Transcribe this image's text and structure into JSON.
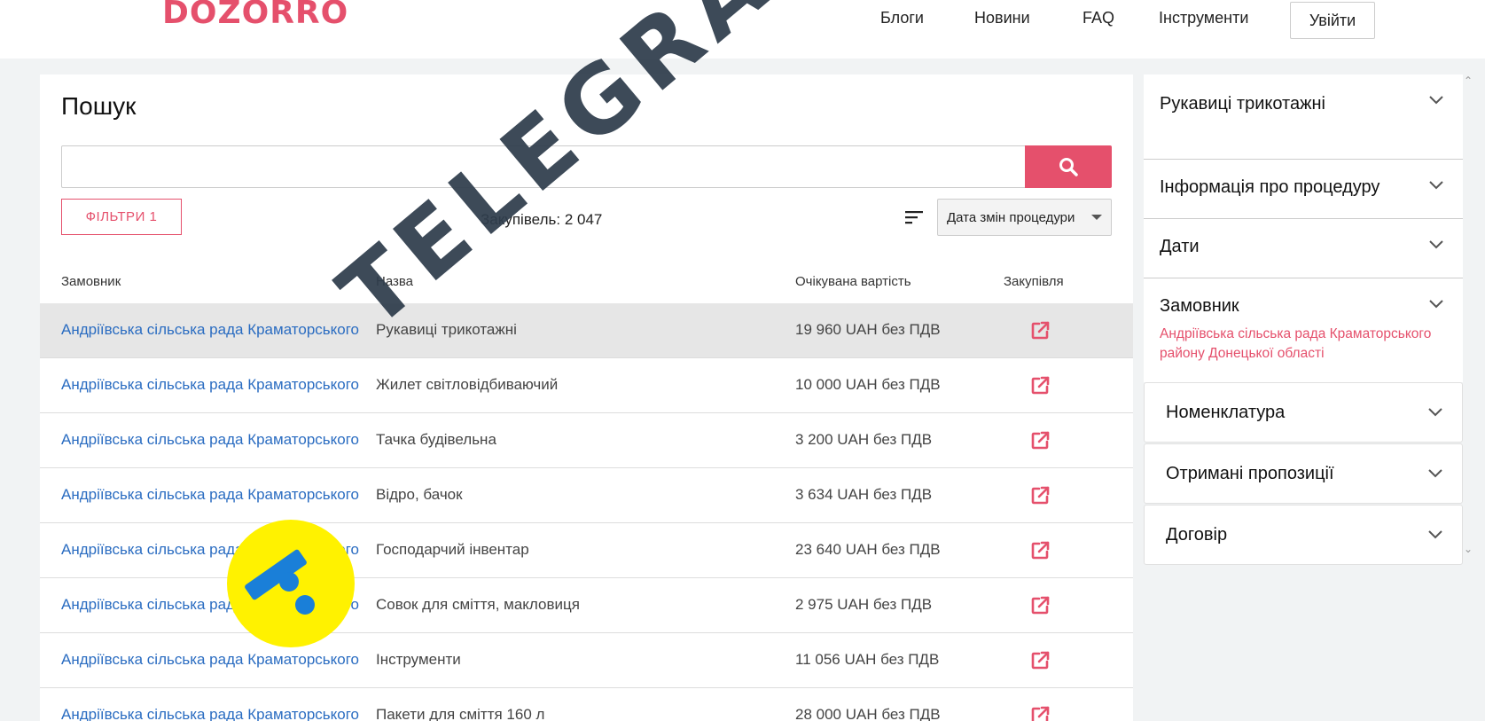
{
  "header": {
    "logo_text": "DOZORRO",
    "nav": [
      {
        "label": "Блоги"
      },
      {
        "label": "Новини"
      },
      {
        "label": "FAQ"
      },
      {
        "label": "Інструменти"
      }
    ],
    "login_label": "Увійти"
  },
  "main": {
    "title": "Пошук",
    "search": {
      "value": "",
      "placeholder": ""
    },
    "filters_label": "ФІЛЬТРИ 1",
    "count_label": "Закупівель:",
    "count_value": "2 047",
    "sort_selected": "Дата змін процедури",
    "columns": [
      "Замовник",
      "Назва",
      "Очікувана вартість",
      "Закупівля"
    ],
    "rows": [
      {
        "customer": "Андріївська сільська рада Краматорського",
        "name": "Рукавиці трикотажні",
        "price": "19 960 UAH без ПДВ"
      },
      {
        "customer": "Андріївська сільська рада Краматорського",
        "name": "Жилет світловідбиваючий",
        "price": "10 000 UAH без ПДВ"
      },
      {
        "customer": "Андріївська сільська рада Краматорського",
        "name": "Тачка будівельна",
        "price": "3 200 UAH без ПДВ"
      },
      {
        "customer": "Андріївська сільська рада Краматорського",
        "name": "Відро, бачок",
        "price": "3 634 UAH без ПДВ"
      },
      {
        "customer": "Андріївська сільська рада Краматорського",
        "name": "Господарчий інвентар",
        "price": "23 640 UAH без ПДВ"
      },
      {
        "customer": "Андріївська сільська рада Краматорського",
        "name": "Совок для сміття, макловиця",
        "price": "2 975 UAH без ПДВ"
      },
      {
        "customer": "Андріївська сільська рада Краматорського",
        "name": "Інструменти",
        "price": "11 056 UAH без ПДВ"
      },
      {
        "customer": "Андріївська сільська рада Краматорського",
        "name": "Пакети для сміття 160 л",
        "price": "28 000 UAH без ПДВ"
      }
    ],
    "selected_row": 0
  },
  "sidebar": {
    "title_section": "Рукавиці трикотажні",
    "sections": [
      "Інформація про процедуру",
      "Дати",
      "Замовник"
    ],
    "customer_full": "Андріївська сільська рада Краматорського району Донецької області",
    "boxes": [
      "Номенклатура",
      "Отримані пропозиції",
      "Договір"
    ]
  },
  "overlay": {
    "watermark_text": "TELEGRAF",
    "logo_name": "telegraf-logo",
    "brand_color": "#e5506c",
    "watermark_color": "#2f3d4c",
    "logo_color": "#fff200",
    "logo_mark_color": "#1a7fd8"
  }
}
